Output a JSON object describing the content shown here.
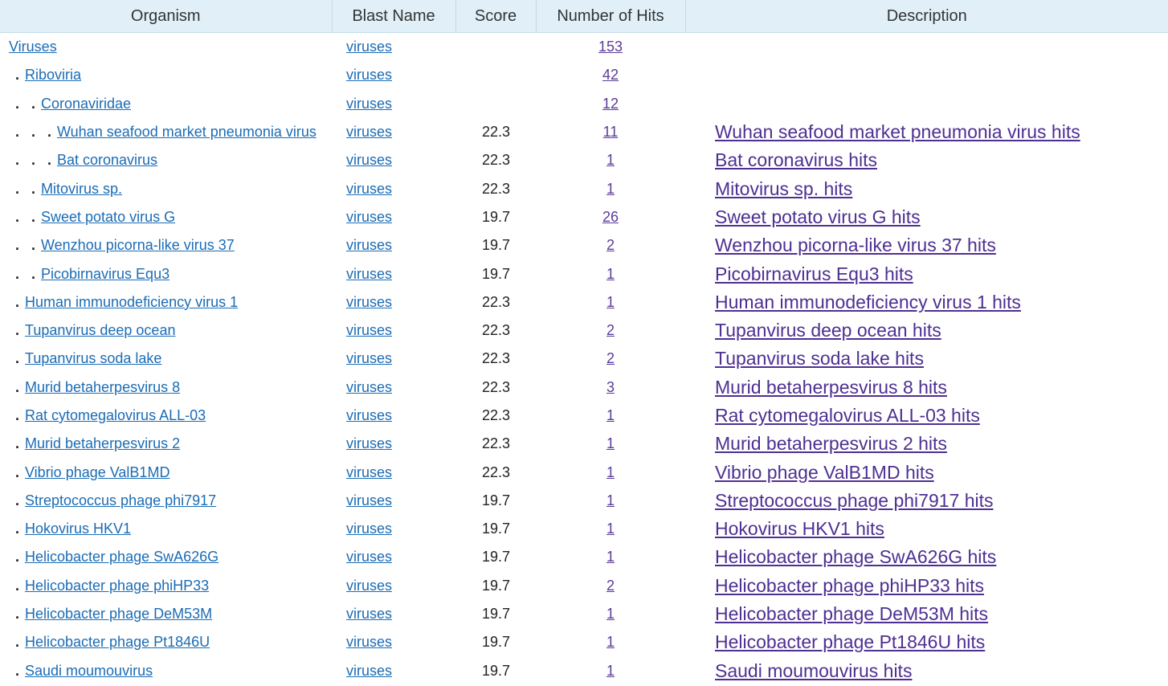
{
  "table": {
    "headers": {
      "organism": "Organism",
      "blast_name": "Blast Name",
      "score": "Score",
      "hits": "Number of Hits",
      "description": "Description"
    },
    "rows": [
      {
        "depth": 0,
        "organism": "Viruses",
        "blast_name": "viruses",
        "score": "",
        "hits": "153",
        "description": ""
      },
      {
        "depth": 1,
        "organism": "Riboviria",
        "blast_name": "viruses",
        "score": "",
        "hits": "42",
        "description": ""
      },
      {
        "depth": 2,
        "organism": "Coronaviridae",
        "blast_name": "viruses",
        "score": "",
        "hits": "12",
        "description": ""
      },
      {
        "depth": 3,
        "organism": "Wuhan seafood market pneumonia virus",
        "blast_name": "viruses",
        "score": "22.3",
        "hits": "11",
        "description": "Wuhan seafood market pneumonia virus hits"
      },
      {
        "depth": 3,
        "organism": "Bat coronavirus",
        "blast_name": "viruses",
        "score": "22.3",
        "hits": "1",
        "description": "Bat coronavirus hits"
      },
      {
        "depth": 2,
        "organism": "Mitovirus sp.",
        "blast_name": "viruses",
        "score": "22.3",
        "hits": "1",
        "description": "Mitovirus sp. hits"
      },
      {
        "depth": 2,
        "organism": "Sweet potato virus G",
        "blast_name": "viruses",
        "score": "19.7",
        "hits": "26",
        "description": "Sweet potato virus G hits"
      },
      {
        "depth": 2,
        "organism": "Wenzhou picorna-like virus 37",
        "blast_name": "viruses",
        "score": "19.7",
        "hits": "2",
        "description": "Wenzhou picorna-like virus 37 hits"
      },
      {
        "depth": 2,
        "organism": "Picobirnavirus Equ3",
        "blast_name": "viruses",
        "score": "19.7",
        "hits": "1",
        "description": "Picobirnavirus Equ3 hits"
      },
      {
        "depth": 1,
        "organism": "Human immunodeficiency virus 1",
        "blast_name": "viruses",
        "score": "22.3",
        "hits": "1",
        "description": "Human immunodeficiency virus 1 hits"
      },
      {
        "depth": 1,
        "organism": "Tupanvirus deep ocean",
        "blast_name": "viruses",
        "score": "22.3",
        "hits": "2",
        "description": "Tupanvirus deep ocean hits"
      },
      {
        "depth": 1,
        "organism": "Tupanvirus soda lake",
        "blast_name": "viruses",
        "score": "22.3",
        "hits": "2",
        "description": "Tupanvirus soda lake hits"
      },
      {
        "depth": 1,
        "organism": "Murid betaherpesvirus 8",
        "blast_name": "viruses",
        "score": "22.3",
        "hits": "3",
        "description": "Murid betaherpesvirus 8 hits"
      },
      {
        "depth": 1,
        "organism": "Rat cytomegalovirus ALL-03",
        "blast_name": "viruses",
        "score": "22.3",
        "hits": "1",
        "description": "Rat cytomegalovirus ALL-03 hits"
      },
      {
        "depth": 1,
        "organism": "Murid betaherpesvirus 2",
        "blast_name": "viruses",
        "score": "22.3",
        "hits": "1",
        "description": "Murid betaherpesvirus 2 hits"
      },
      {
        "depth": 1,
        "organism": "Vibrio phage ValB1MD",
        "blast_name": "viruses",
        "score": "22.3",
        "hits": "1",
        "description": "Vibrio phage ValB1MD hits"
      },
      {
        "depth": 1,
        "organism": "Streptococcus phage phi7917",
        "blast_name": "viruses",
        "score": "19.7",
        "hits": "1",
        "description": "Streptococcus phage phi7917 hits"
      },
      {
        "depth": 1,
        "organism": "Hokovirus HKV1",
        "blast_name": "viruses",
        "score": "19.7",
        "hits": "1",
        "description": "Hokovirus HKV1 hits"
      },
      {
        "depth": 1,
        "organism": "Helicobacter phage SwA626G",
        "blast_name": "viruses",
        "score": "19.7",
        "hits": "1",
        "description": "Helicobacter phage SwA626G hits"
      },
      {
        "depth": 1,
        "organism": "Helicobacter phage phiHP33",
        "blast_name": "viruses",
        "score": "19.7",
        "hits": "2",
        "description": "Helicobacter phage phiHP33 hits"
      },
      {
        "depth": 1,
        "organism": "Helicobacter phage DeM53M",
        "blast_name": "viruses",
        "score": "19.7",
        "hits": "1",
        "description": "Helicobacter phage DeM53M hits"
      },
      {
        "depth": 1,
        "organism": "Helicobacter phage Pt1846U",
        "blast_name": "viruses",
        "score": "19.7",
        "hits": "1",
        "description": "Helicobacter phage Pt1846U hits"
      },
      {
        "depth": 1,
        "organism": "Saudi moumouvirus",
        "blast_name": "viruses",
        "score": "19.7",
        "hits": "1",
        "description": "Saudi moumouvirus hits"
      }
    ]
  },
  "colors": {
    "header_bg": "#e1f0f8",
    "link_blue": "#1b6cb5",
    "visited_purple": "#4e2f92"
  }
}
